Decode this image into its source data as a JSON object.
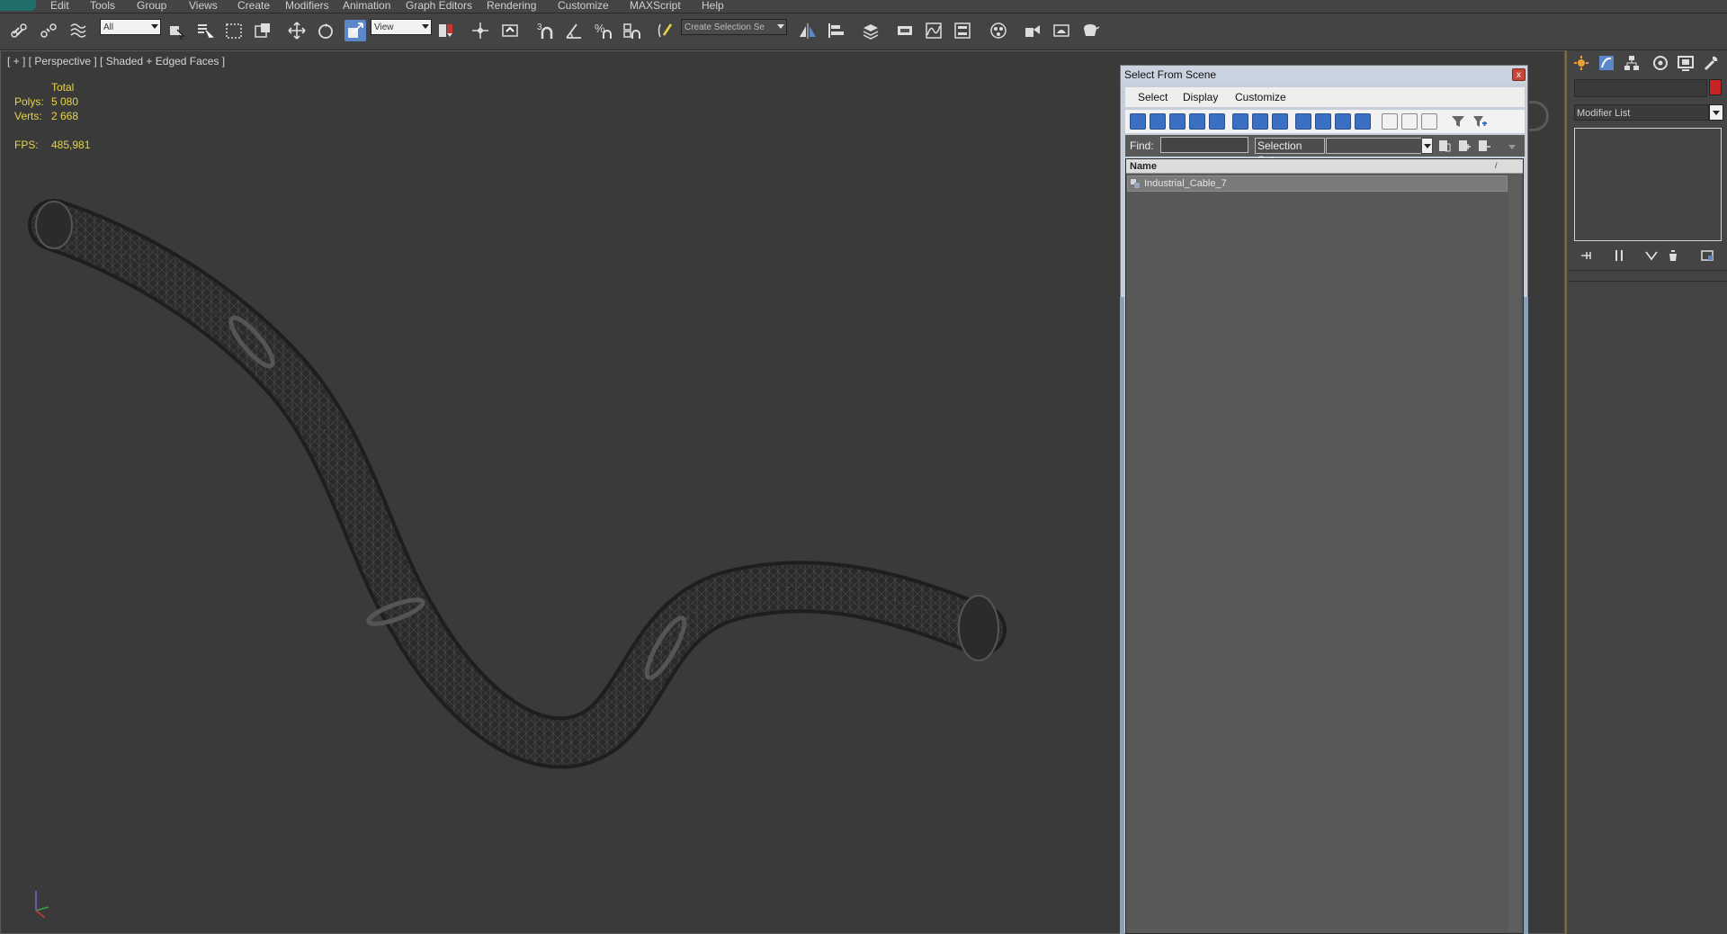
{
  "menubar": {
    "items": [
      "Edit",
      "Tools",
      "Group",
      "Views",
      "Create",
      "Modifiers",
      "Animation",
      "Graph Editors",
      "Rendering",
      "Customize",
      "MAXScript",
      "Help"
    ]
  },
  "toolbar": {
    "selection_filter": "All",
    "reference_coord": "View",
    "named_selection": "Create Selection Se",
    "snap_label": "3"
  },
  "viewport": {
    "label": "[ + ] [ Perspective ] [ Shaded + Edged Faces ]",
    "stats": {
      "total_label": "Total",
      "polys_label": "Polys:",
      "polys_value": "5 080",
      "verts_label": "Verts:",
      "verts_value": "2 668",
      "fps_label": "FPS:",
      "fps_value": "485,981"
    }
  },
  "command_panel": {
    "modifier_list_label": "Modifier List",
    "object_color": "#c82424"
  },
  "dialog": {
    "title": "Select From Scene",
    "close_label": "x",
    "menus": [
      "Select",
      "Display",
      "Customize"
    ],
    "find_label": "Find:",
    "find_value": "",
    "selection_set_label": "Selection Set:",
    "list_header": "Name",
    "sort_indicator": "/",
    "rows": [
      "Industrial_Cable_7"
    ]
  },
  "colors": {
    "stats_text": "#e8d44a",
    "dialog_chrome": "#c9d4e0",
    "toolbar_blue": "#3b6fc4"
  }
}
